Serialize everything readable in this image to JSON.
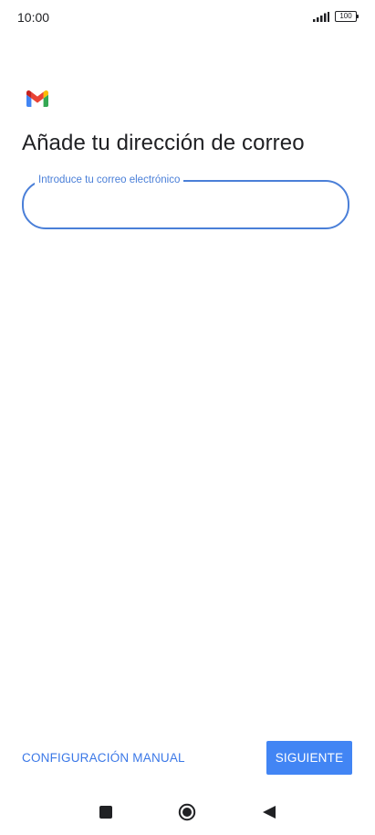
{
  "status_bar": {
    "time": "10:00",
    "battery": "100",
    "signal_icon": "signal-bars-icon",
    "battery_icon": "battery-icon"
  },
  "app": {
    "logo_icon": "gmail-logo-icon",
    "logo_colors": {
      "blue": "#4285f4",
      "green": "#34a853",
      "yellow": "#fbbc04",
      "red": "#ea4335"
    }
  },
  "main": {
    "title": "Añade tu dirección de correo",
    "email_field": {
      "label": "Introduce tu correo electrónico",
      "value": "",
      "accent_color": "#4a7fd8"
    }
  },
  "footer": {
    "manual_config_label": "CONFIGURACIÓN MANUAL",
    "next_label": "SIGUIENTE",
    "primary_color": "#4285f4"
  },
  "nav_bar": {
    "recents_icon": "square-icon",
    "home_icon": "circle-home-icon",
    "back_icon": "triangle-back-icon"
  }
}
